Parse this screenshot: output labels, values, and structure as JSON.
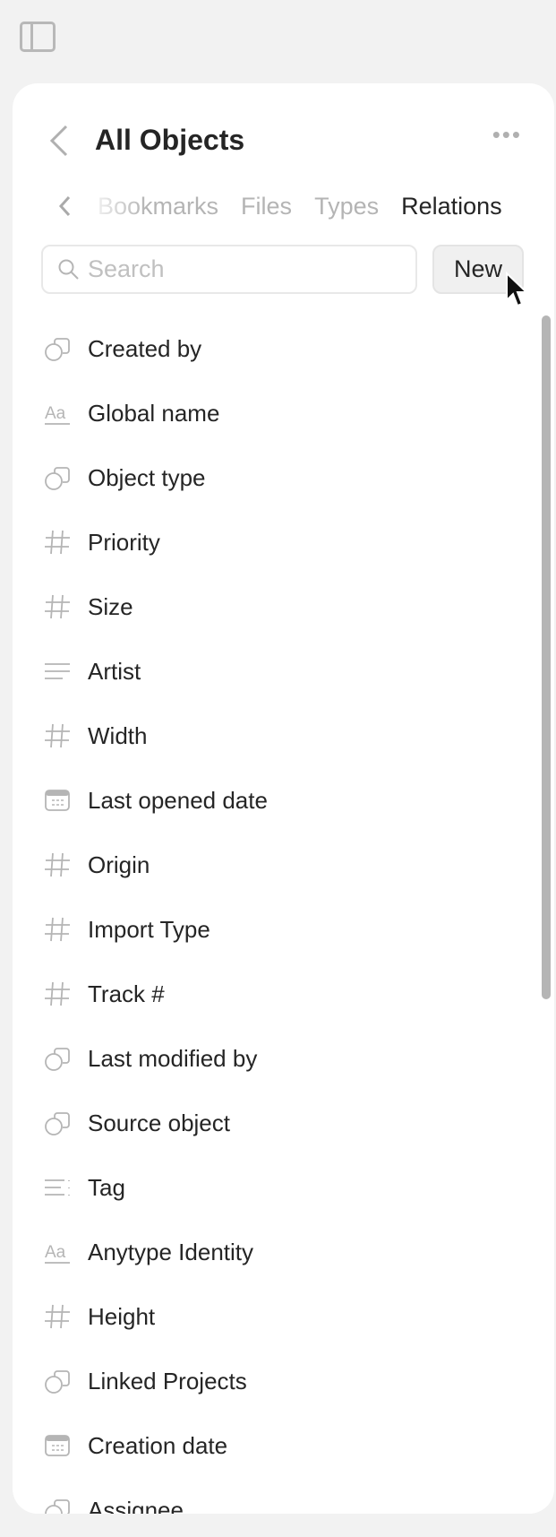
{
  "header": {
    "title": "All Objects"
  },
  "tabs": [
    {
      "label": "Bookmarks"
    },
    {
      "label": "Files"
    },
    {
      "label": "Types"
    },
    {
      "label": "Relations",
      "active": true
    }
  ],
  "search": {
    "placeholder": "Search",
    "value": ""
  },
  "new_label": "New",
  "relations": [
    {
      "label": "Created by",
      "icon": "object"
    },
    {
      "label": "Global name",
      "icon": "text"
    },
    {
      "label": "Object type",
      "icon": "object"
    },
    {
      "label": "Priority",
      "icon": "number"
    },
    {
      "label": "Size",
      "icon": "number"
    },
    {
      "label": "Artist",
      "icon": "longtext"
    },
    {
      "label": "Width",
      "icon": "number"
    },
    {
      "label": "Last opened date",
      "icon": "date"
    },
    {
      "label": "Origin",
      "icon": "number"
    },
    {
      "label": "Import Type",
      "icon": "number"
    },
    {
      "label": "Track #",
      "icon": "number"
    },
    {
      "label": "Last modified by",
      "icon": "object"
    },
    {
      "label": "Source object",
      "icon": "object"
    },
    {
      "label": "Tag",
      "icon": "tag"
    },
    {
      "label": "Anytype Identity",
      "icon": "text"
    },
    {
      "label": "Height",
      "icon": "number"
    },
    {
      "label": "Linked Projects",
      "icon": "object"
    },
    {
      "label": "Creation date",
      "icon": "date"
    },
    {
      "label": "Assignee",
      "icon": "object"
    }
  ]
}
